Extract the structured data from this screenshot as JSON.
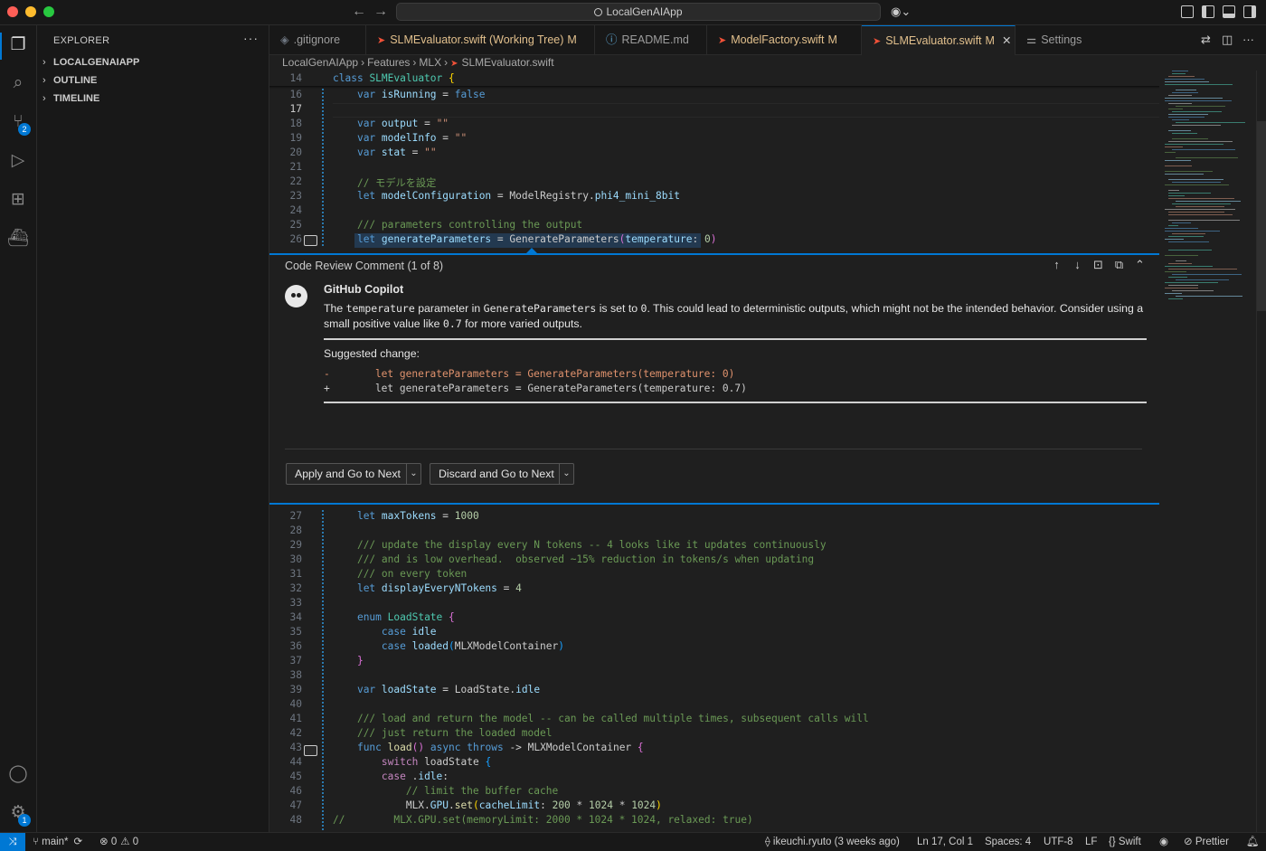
{
  "titlebar": {
    "search_text": "LocalGenAIApp"
  },
  "activity": {
    "source_control_badge": "2",
    "accounts_badge": "1"
  },
  "sidebar": {
    "title": "EXPLORER",
    "sections": [
      "LOCALGENAIAPP",
      "OUTLINE",
      "TIMELINE"
    ]
  },
  "tabs": [
    {
      "label": ".gitignore",
      "modified": ""
    },
    {
      "label": "SLMEvaluator.swift (Working Tree)",
      "modified": "M"
    },
    {
      "label": "README.md",
      "modified": ""
    },
    {
      "label": "ModelFactory.swift",
      "modified": "M"
    },
    {
      "label": "SLMEvaluator.swift",
      "modified": "M"
    },
    {
      "label": "Settings",
      "modified": ""
    }
  ],
  "breadcrumb": [
    "LocalGenAIApp",
    "Features",
    "MLX",
    "SLMEvaluator.swift"
  ],
  "editor": {
    "sticky": {
      "num": "14",
      "kw": "class",
      "name": "SLMEvaluator",
      "brace": "{"
    },
    "line_nums_top": [
      "16",
      "17",
      "18",
      "19",
      "20",
      "21",
      "22",
      "23",
      "24",
      "25",
      "26"
    ],
    "line_nums_bottom": [
      "27",
      "28",
      "29",
      "30",
      "31",
      "32",
      "33",
      "34",
      "35",
      "36",
      "37",
      "38",
      "39",
      "40",
      "41",
      "42",
      "43",
      "44",
      "45",
      "46",
      "47",
      "48"
    ],
    "comment_jp": "// モデルを設定",
    "comment_params": "/// parameters controlling the output",
    "comment_display1": "/// update the display every N tokens -- 4 looks like it updates continuously",
    "comment_display2": "/// and is low overhead.  observed ~15% reduction in tokens/s when updating",
    "comment_display3": "/// on every token",
    "comment_load1": "/// load and return the model -- can be called multiple times, subsequent calls will",
    "comment_load2": "/// just return the loaded model",
    "comment_cache": "// limit the buffer cache",
    "comment_line48": "//        MLX.GPU.set(memoryLimit: 2000 * 1024 * 1024, relaxed: true)"
  },
  "review": {
    "title": "Code Review Comment (1 of 8)",
    "author": "GitHub Copilot",
    "body_1": "The ",
    "body_code1": "temperature",
    "body_2": " parameter in ",
    "body_code2": "GenerateParameters",
    "body_3": " is set to ",
    "body_code3": "0",
    "body_4": ". This could lead to deterministic outputs, which might not be the intended behavior. Consider using a small positive value like ",
    "body_code4": "0.7",
    "body_5": " for more varied outputs.",
    "suggested_label": "Suggested change:",
    "diff_del_sign": "-",
    "diff_del": "    let generateParameters = GenerateParameters(temperature: 0)",
    "diff_add_sign": "+",
    "diff_add": "    let generateParameters = GenerateParameters(temperature: 0.7)",
    "apply_button": "Apply and Go to Next",
    "discard_button": "Discard and Go to Next"
  },
  "status": {
    "branch": "main*",
    "errors": "0",
    "warnings": "0",
    "blame": "ikeuchi.ryuto (3 weeks ago)",
    "position": "Ln 17, Col 1",
    "spaces": "Spaces: 4",
    "encoding": "UTF-8",
    "eol": "LF",
    "language": "Swift",
    "formatter": "Prettier"
  },
  "colors": {
    "accent": "#0078d4",
    "keyword": "#569cd6",
    "type": "#4ec9b0",
    "string": "#ce9178",
    "comment": "#6a9955",
    "swift_icon": "#f05138",
    "modified": "#e2c08d"
  }
}
